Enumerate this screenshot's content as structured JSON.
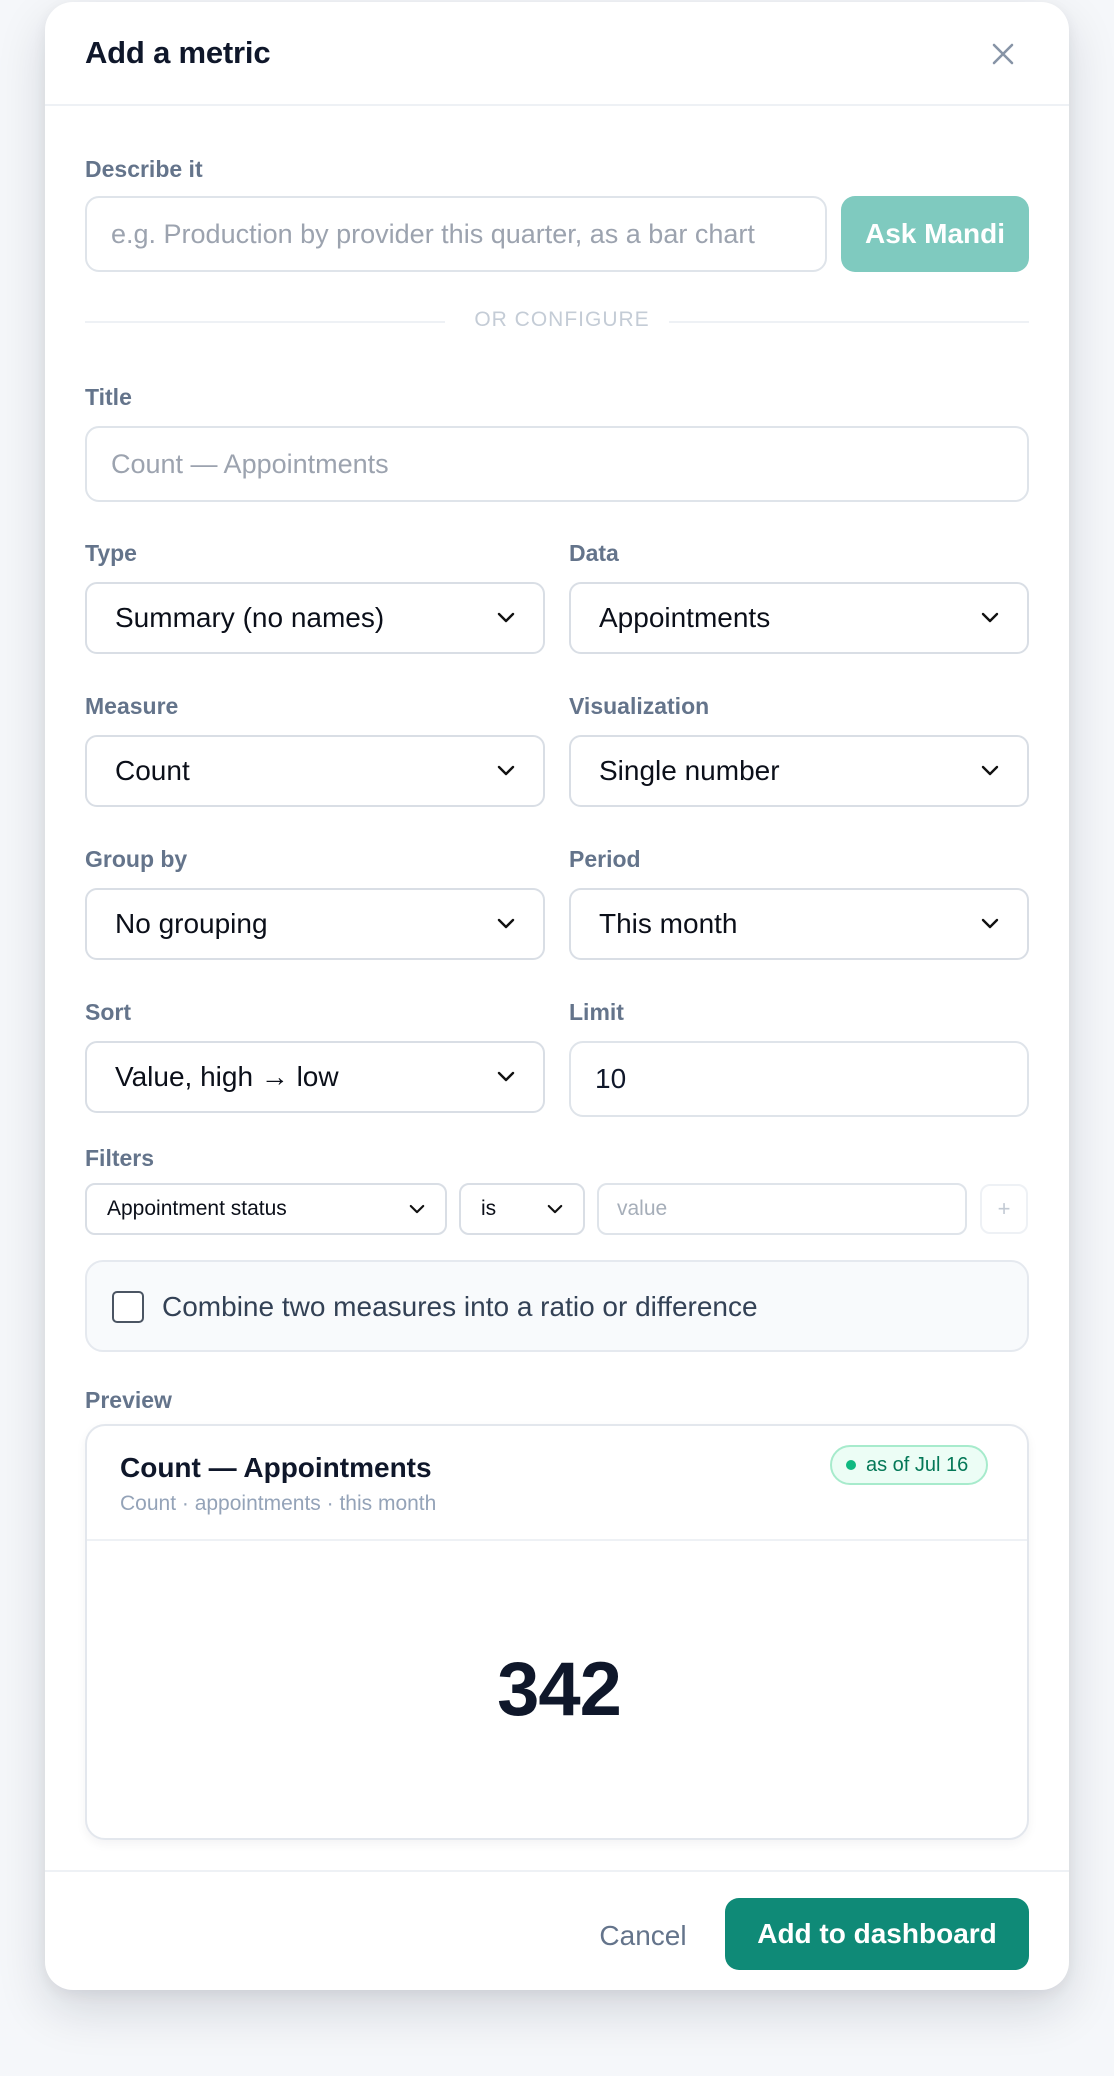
{
  "modal": {
    "title": "Add a metric",
    "close_icon": "close-icon"
  },
  "describe": {
    "label": "Describe it",
    "placeholder": "e.g. Production by provider this quarter, as a bar chart",
    "ask_button": "Ask Mandi"
  },
  "divider_text": "OR CONFIGURE",
  "title_field": {
    "label": "Title",
    "placeholder": "Count — Appointments"
  },
  "type": {
    "label": "Type",
    "value": "Summary (no names)"
  },
  "data_source": {
    "label": "Data",
    "value": "Appointments"
  },
  "measure": {
    "label": "Measure",
    "value": "Count"
  },
  "visualization": {
    "label": "Visualization",
    "value": "Single number"
  },
  "group_by": {
    "label": "Group by",
    "value": "No grouping"
  },
  "period": {
    "label": "Period",
    "value": "This month"
  },
  "sort": {
    "label": "Sort",
    "value": "Value, high → low"
  },
  "limit": {
    "label": "Limit",
    "value": "10"
  },
  "filters": {
    "label": "Filters",
    "field": "Appointment status",
    "operator": "is",
    "value_placeholder": "value",
    "add_label": "+"
  },
  "combine": {
    "label": "Combine two measures into a ratio or difference",
    "checked": false
  },
  "preview": {
    "label": "Preview",
    "title": "Count — Appointments",
    "subtitle": "Count · appointments · this month",
    "badge": "as of Jul 16",
    "value": "342"
  },
  "footer": {
    "cancel": "Cancel",
    "add": "Add to dashboard"
  },
  "colors": {
    "accent": "#0f8a77",
    "accent_muted": "#7fcabf",
    "badge_green": "#10b981"
  }
}
